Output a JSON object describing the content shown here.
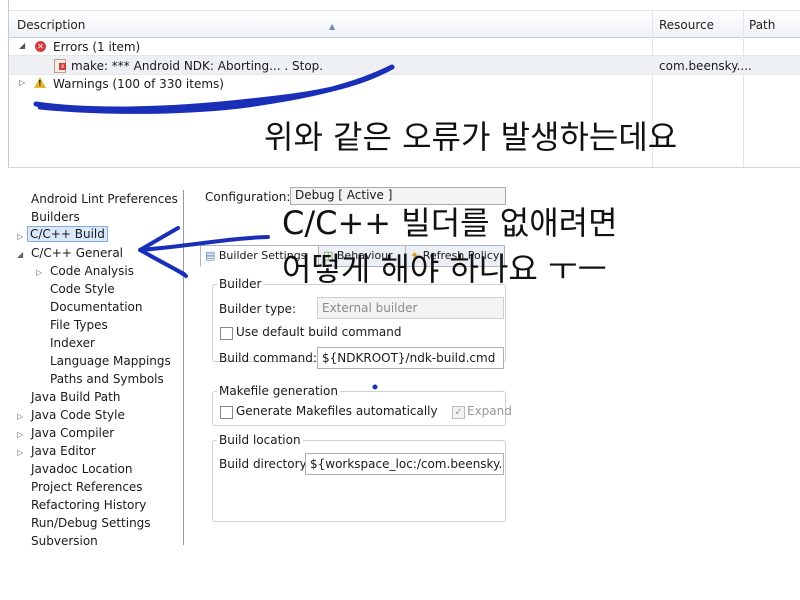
{
  "problems": {
    "columns": [
      "Description",
      "Resource",
      "Path"
    ],
    "errors_group": "Errors (1 item)",
    "error_row": {
      "description": "make: *** Android NDK: Aborting...    .  Stop.",
      "resource": "com.beensky...."
    },
    "warnings_group": "Warnings (100 of 330 items)"
  },
  "properties": {
    "tree": [
      "Android Lint Preferences",
      "Builders",
      "C/C++ Build",
      "C/C++ General",
      "Code Analysis",
      "Code Style",
      "Documentation",
      "File Types",
      "Indexer",
      "Language Mappings",
      "Paths and Symbols",
      "Java Build Path",
      "Java Code Style",
      "Java Compiler",
      "Java Editor",
      "Javadoc Location",
      "Project References",
      "Refactoring History",
      "Run/Debug Settings",
      "Subversion"
    ],
    "configuration_label": "Configuration:",
    "configuration_value": "Debug  [ Active ]",
    "tabs": [
      "Builder Settings",
      "Behaviour",
      "Refresh Policy"
    ],
    "builder_group": "Builder",
    "builder_type_label": "Builder type:",
    "builder_type_value": "External builder",
    "use_default_label": "Use default build command",
    "build_command_label": "Build command:",
    "build_command_value": "${NDKROOT}/ndk-build.cmd",
    "makefile_group": "Makefile generation",
    "generate_makefiles_label": "Generate Makefiles automatically",
    "expand_label": "Expand",
    "build_location_group": "Build location",
    "build_directory_label": "Build directory:",
    "build_directory_value": "${workspace_loc:/com.beensky.artsk"
  },
  "annotations": {
    "line1": "위와 같은 오류가 발생하는데요",
    "line2": "C/C++ 빌더를 없애려면",
    "line3": "어떻게 해야 하나요 ㅜㅡ"
  }
}
